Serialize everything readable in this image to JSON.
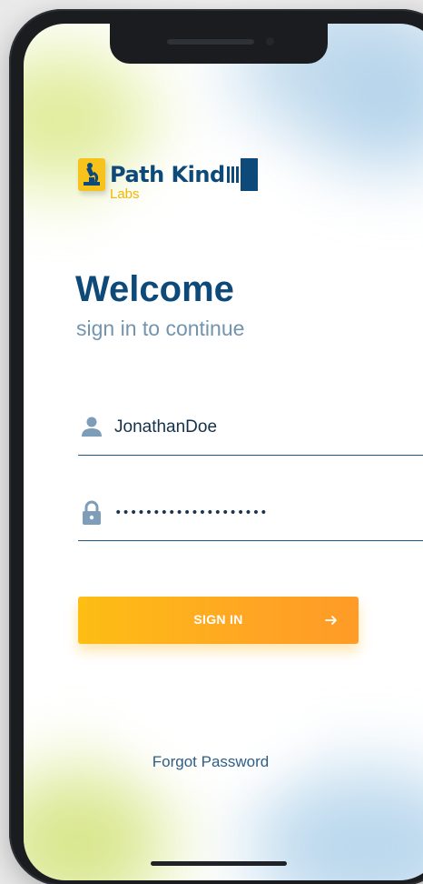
{
  "logo": {
    "name": "Path Kind",
    "sub": "Labs"
  },
  "welcome": {
    "title": "Welcome",
    "subtitle": "sign in to continue"
  },
  "form": {
    "username_value": "JonathanDoe",
    "password_value": "********************",
    "signin_label": "SIGN IN"
  },
  "links": {
    "forgot_password": "Forgot Password"
  },
  "icons": {
    "username": "user-icon",
    "password": "lock-icon",
    "signin": "arrow-right-icon",
    "logo": "microscope-icon"
  },
  "colors": {
    "brand_blue": "#0d4a7a",
    "brand_yellow": "#f7c21a",
    "button_start": "#fdbe14",
    "button_end": "#ff9b27",
    "subtitle": "#7394ae"
  }
}
